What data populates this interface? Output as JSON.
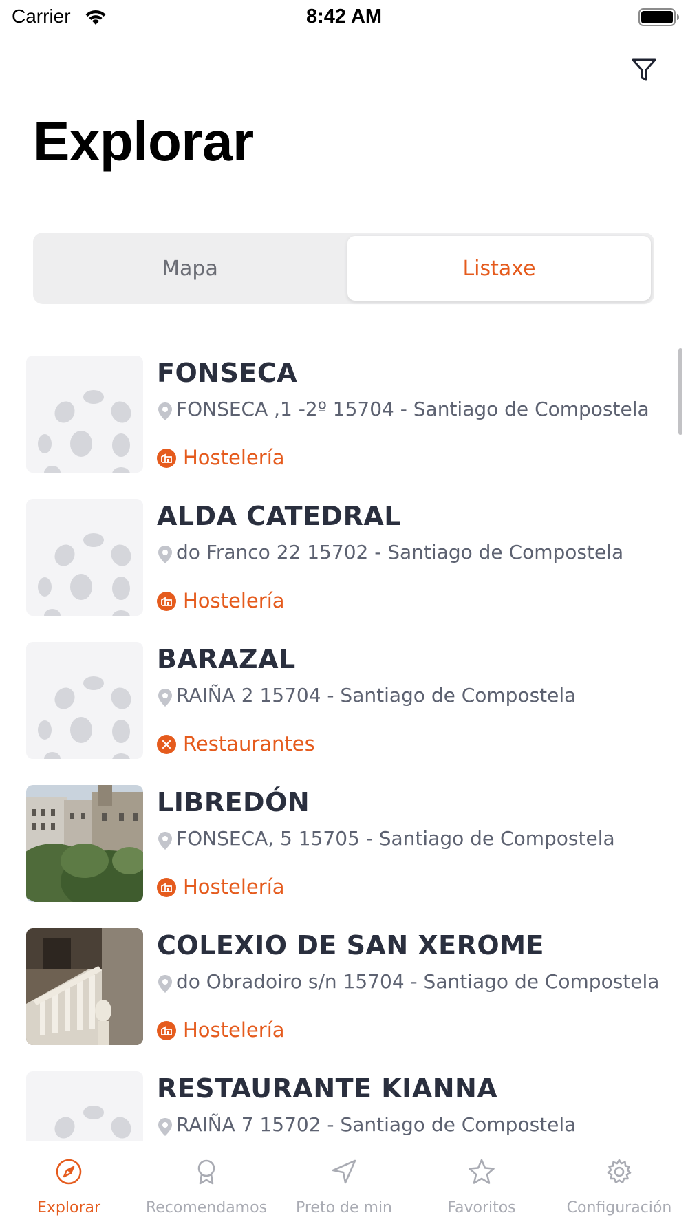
{
  "status_bar": {
    "carrier": "Carrier",
    "time": "8:42 AM"
  },
  "header": {
    "title": "Explorar",
    "filter_icon": "filter-icon"
  },
  "segmented_control": {
    "options": [
      {
        "label": "Mapa",
        "selected": false
      },
      {
        "label": "Listaxe",
        "selected": true
      }
    ]
  },
  "list": {
    "items": [
      {
        "title": "FONSECA",
        "address": "FONSECA ,1 -2º 15704 - Santiago de Compostela",
        "category": "Hostelería",
        "category_icon": "hotel-icon",
        "image": "placeholder"
      },
      {
        "title": "ALDA CATEDRAL",
        "address": "do Franco 22 15702 - Santiago de Compostela",
        "category": "Hostelería",
        "category_icon": "hotel-icon",
        "image": "placeholder"
      },
      {
        "title": "BARAZAL",
        "address": "RAIÑA 2 15704 - Santiago de Compostela",
        "category": "Restaurantes",
        "category_icon": "cutlery-icon",
        "image": "placeholder"
      },
      {
        "title": "LIBREDÓN",
        "address": "FONSECA, 5 15705 - Santiago de Compostela",
        "category": "Hostelería",
        "category_icon": "hotel-icon",
        "image": "photo-building-square"
      },
      {
        "title": "COLEXIO DE SAN XEROME",
        "address": "do Obradoiro s/n 15704 - Santiago de Compostela",
        "category": "Hostelería",
        "category_icon": "hotel-icon",
        "image": "photo-stone-staircase"
      },
      {
        "title": "RESTAURANTE KIANNA",
        "address": "RAIÑA 7 15702 - Santiago de Compostela",
        "category": "",
        "category_icon": "",
        "image": "placeholder"
      }
    ]
  },
  "tab_bar": {
    "tabs": [
      {
        "label": "Explorar",
        "icon": "compass-icon",
        "active": true
      },
      {
        "label": "Recomendamos",
        "icon": "award-icon",
        "active": false
      },
      {
        "label": "Preto de min",
        "icon": "location-arrow-icon",
        "active": false
      },
      {
        "label": "Favoritos",
        "icon": "star-icon",
        "active": false
      },
      {
        "label": "Configuración",
        "icon": "gear-icon",
        "active": false
      }
    ]
  },
  "colors": {
    "accent": "#e55b1d",
    "title_text": "#2a2f3e",
    "secondary_text": "#5d6271",
    "inactive_tab": "#a9abb3"
  }
}
